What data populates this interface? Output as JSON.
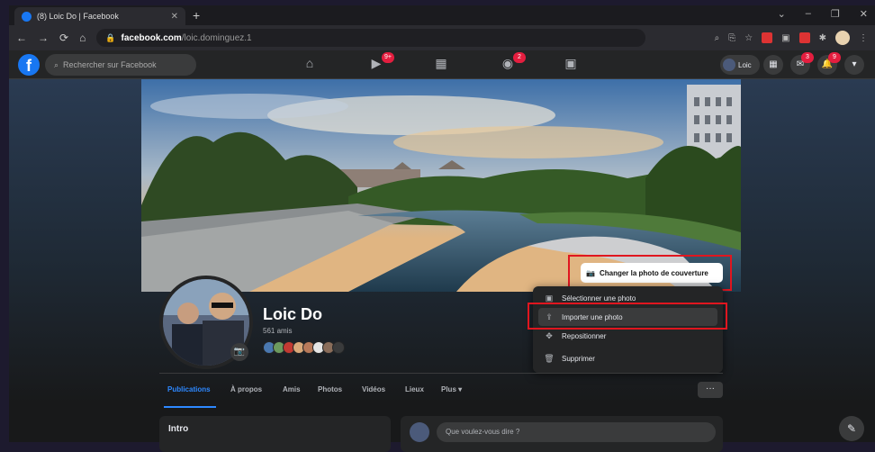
{
  "browser": {
    "tab_title": "(8) Loic Do | Facebook",
    "tab_close": "✕",
    "new_tab": "+",
    "url_domain": "facebook.com",
    "url_path": "/loic.dominguez.1"
  },
  "header": {
    "logo": "f",
    "search_placeholder": "Rechercher sur Facebook",
    "badges": {
      "watch": "9+",
      "gaming": "2",
      "messenger": "3",
      "notifications": "9"
    },
    "user_chip": "Loic"
  },
  "profile": {
    "name": "Loic Do",
    "friends": "561 amis",
    "cover_button": "Changer la photo de couverture"
  },
  "cover_menu": {
    "items": [
      {
        "label": "Sélectionner une photo",
        "icon": "image-icon"
      },
      {
        "label": "Importer une photo",
        "icon": "upload-icon"
      },
      {
        "label": "Repositionner",
        "icon": "move-icon"
      },
      {
        "label": "Supprimer",
        "icon": "trash-icon"
      }
    ]
  },
  "tabs": {
    "items": [
      "Publications",
      "À propos",
      "Amis",
      "Photos",
      "Vidéos",
      "Lieux",
      "Plus ▾"
    ],
    "more": "···"
  },
  "intro": {
    "title": "Intro"
  },
  "composer": {
    "placeholder": "Que voulez-vous dire ?"
  },
  "colors": {
    "fb_blue": "#1877f2",
    "highlight_red": "#e0161f",
    "dark_bg": "#18191a"
  }
}
